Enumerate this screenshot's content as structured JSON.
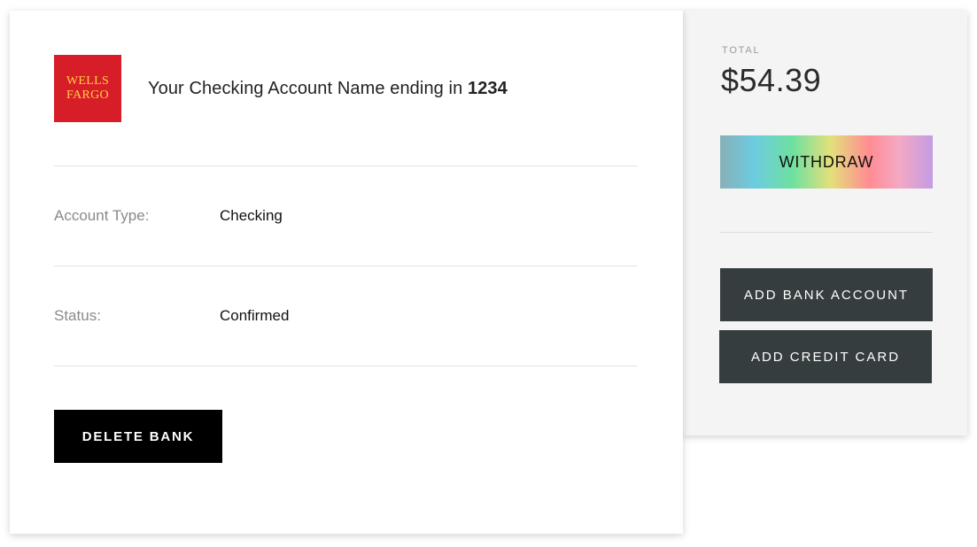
{
  "bank": {
    "logo_line1": "WELLS",
    "logo_line2": "FARGO",
    "title_prefix": "Your Checking Account Name ending in ",
    "account_last4": "1234"
  },
  "details": [
    {
      "label": "Account Type:",
      "value": "Checking"
    },
    {
      "label": "Status:",
      "value": "Confirmed"
    }
  ],
  "actions": {
    "delete_label": "DELETE BANK"
  },
  "summary": {
    "total_label": "TOTAL",
    "total_value": "$54.39",
    "withdraw_label": "WITHDRAW",
    "add_bank_label": "ADD BANK ACCOUNT",
    "add_card_label": "ADD CREDIT CARD"
  },
  "colors": {
    "logo_background": "#d71e28",
    "logo_text": "#ffcd41",
    "dark_button": "#363d3f",
    "delete_button": "#000000",
    "side_panel": "#f4f4f4"
  },
  "icons": {
    "bank_logo": "wells-fargo-logo"
  }
}
